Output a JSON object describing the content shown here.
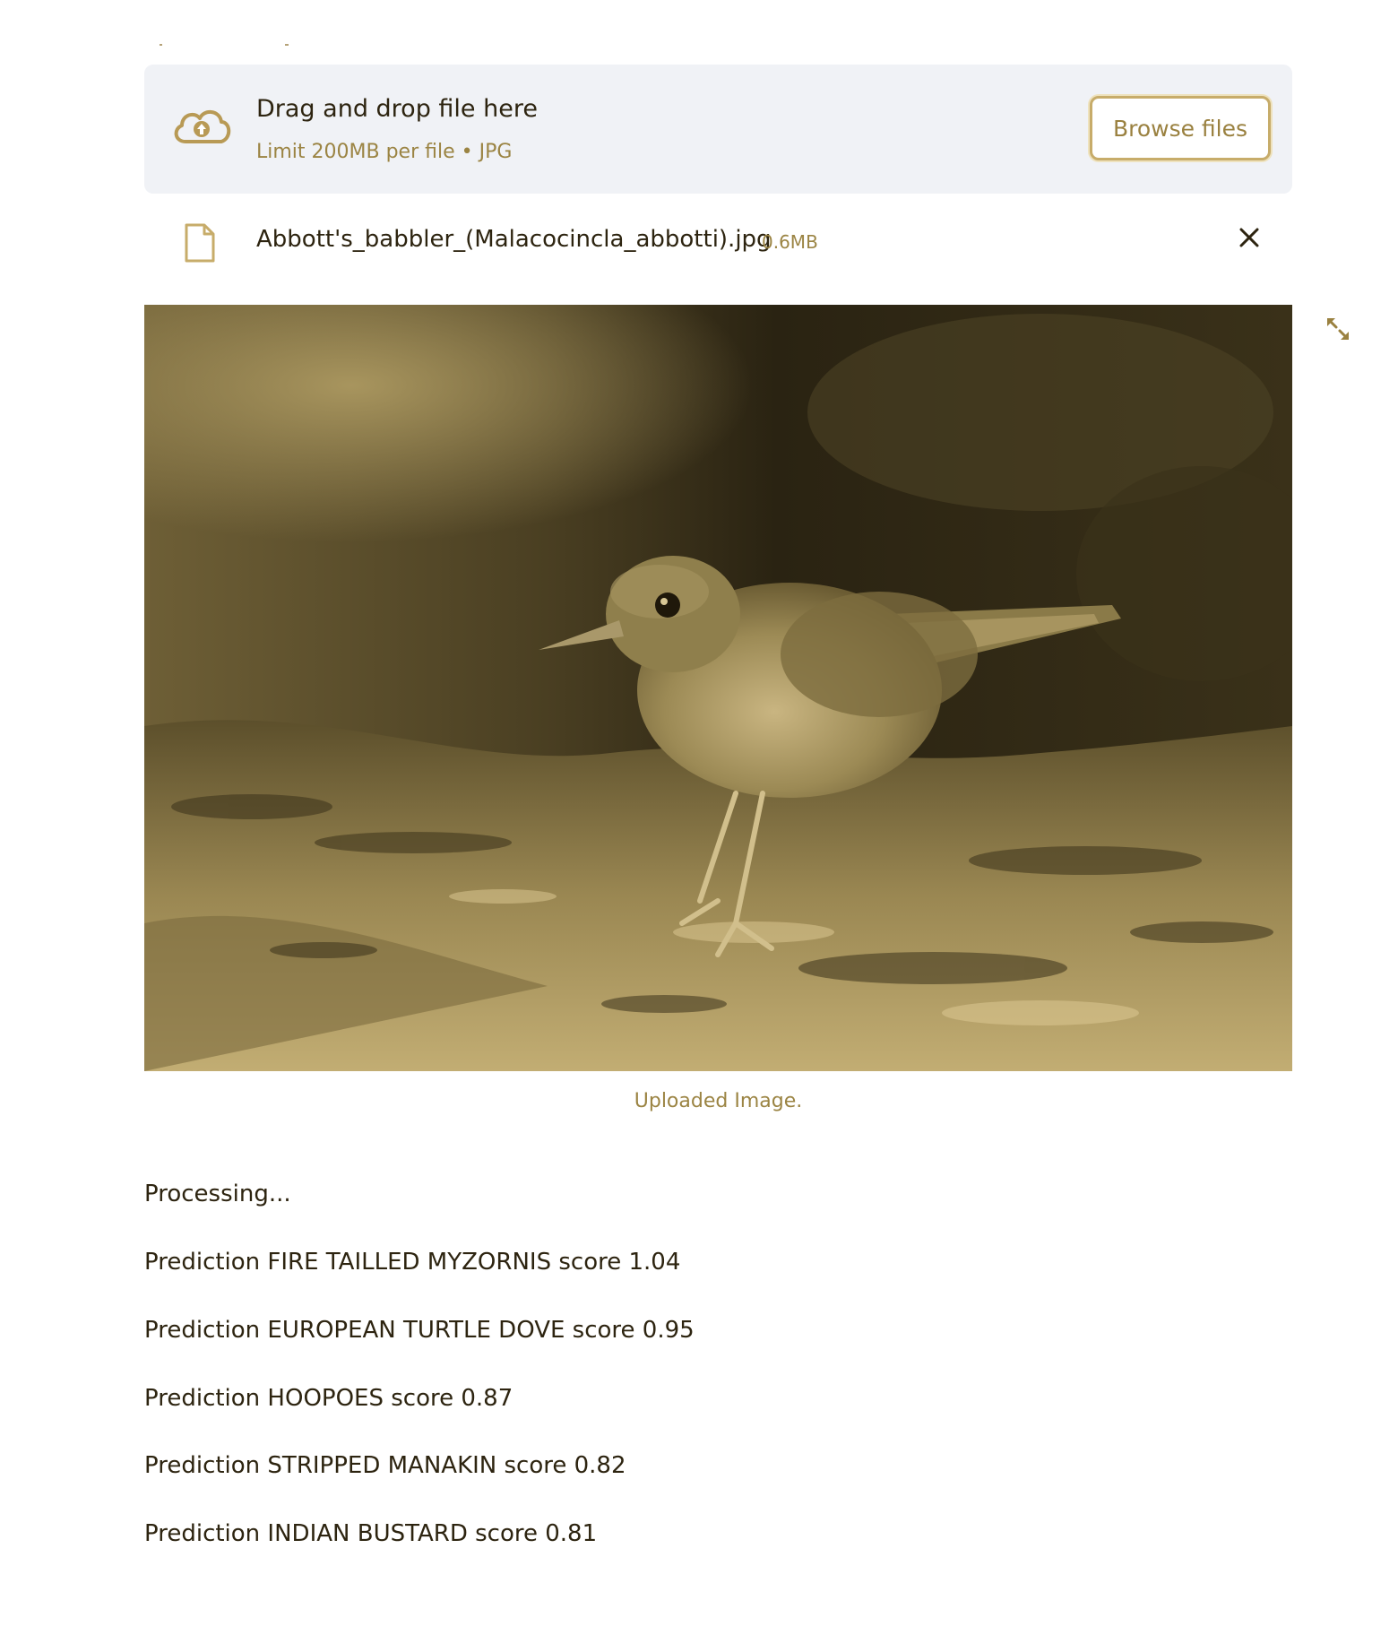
{
  "uploader": {
    "title": "Drag and drop file here",
    "subtitle": "Limit 200MB per file • JPG",
    "browse_label": "Browse files"
  },
  "uploaded_file": {
    "name": "Abbott's_babbler_(Malacocincla_abbotti).jpg",
    "size": "0.6MB"
  },
  "image": {
    "caption": "Uploaded Image.",
    "subject": "bird-photo"
  },
  "output": {
    "status": "Processing...",
    "predictions": [
      "Prediction FIRE TAILLED MYZORNIS score 1.04",
      "Prediction EUROPEAN TURTLE DOVE score 0.95",
      "Prediction HOOPOES score 0.87",
      "Prediction STRIPPED MANAKIN score 0.82",
      "Prediction INDIAN BUSTARD score 0.81"
    ]
  },
  "colors": {
    "accent": "#9a8140",
    "text": "#2d2410",
    "dropzone_bg": "#f0f2f6"
  }
}
